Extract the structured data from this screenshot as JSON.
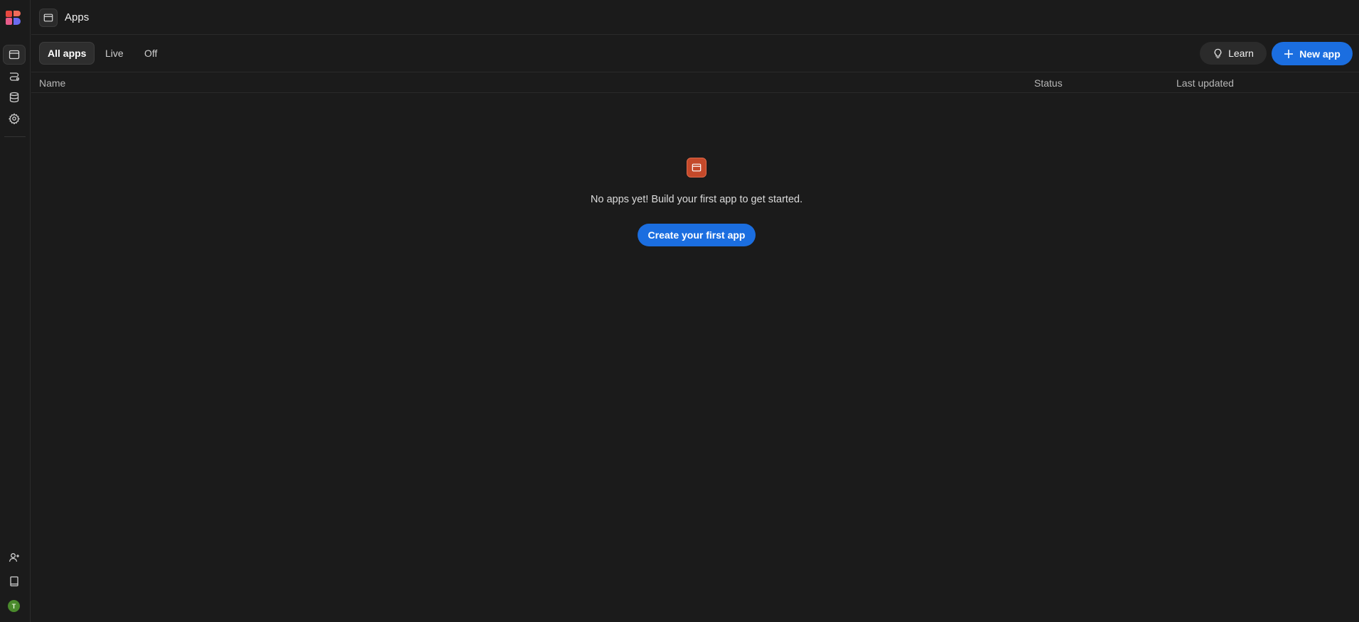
{
  "header": {
    "title": "Apps",
    "icon": "app-window-icon"
  },
  "sidebar": {
    "logo": "brand-logo",
    "items": [
      {
        "name": "apps",
        "icon": "app-window-icon",
        "active": true
      },
      {
        "name": "automations",
        "icon": "workflow-icon",
        "active": false
      },
      {
        "name": "data",
        "icon": "database-icon",
        "active": false
      },
      {
        "name": "settings",
        "icon": "gear-icon",
        "active": false
      }
    ],
    "bottom": [
      {
        "name": "invite-user",
        "icon": "add-user-icon"
      },
      {
        "name": "docs",
        "icon": "book-icon"
      }
    ],
    "avatar_initial": "T"
  },
  "filters": {
    "tabs": [
      {
        "label": "All apps",
        "active": true
      },
      {
        "label": "Live",
        "active": false
      },
      {
        "label": "Off",
        "active": false
      }
    ],
    "learn_label": "Learn",
    "new_app_label": "New app"
  },
  "table": {
    "columns": [
      "Name",
      "Status",
      "Last updated"
    ]
  },
  "empty_state": {
    "message": "No apps yet! Build your first app to get started.",
    "cta_label": "Create your first app"
  },
  "colors": {
    "background": "#1b1b1b",
    "accent": "#1b6ee0",
    "empty_icon": "#c4492a",
    "avatar": "#4a8a2c"
  }
}
